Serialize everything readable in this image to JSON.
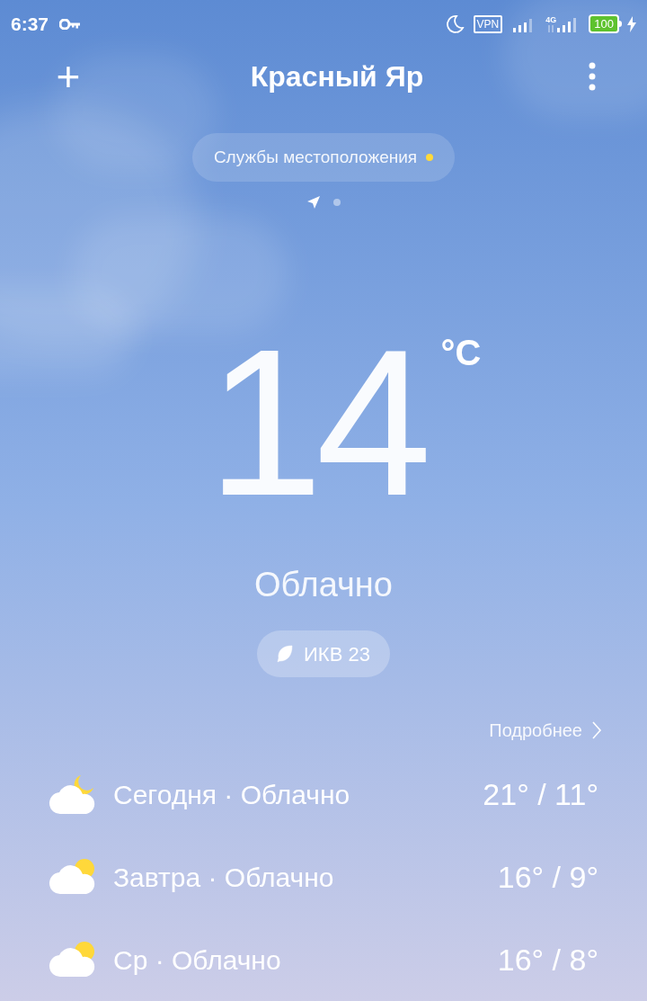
{
  "status_bar": {
    "time": "6:37",
    "vpn": "VPN",
    "network": "4G",
    "battery": "100"
  },
  "header": {
    "add": "+",
    "city": "Красный Яр"
  },
  "location_pill": {
    "label": "Службы местоположения",
    "alert": true
  },
  "pages": [
    {
      "kind": "location",
      "selected": true
    },
    {
      "kind": "dot",
      "selected": false
    }
  ],
  "current": {
    "temperature": "14",
    "unit": "°C",
    "condition": "Облачно"
  },
  "aqi": {
    "label": "ИКВ 23"
  },
  "details_link": "Подробнее",
  "forecast": [
    {
      "kind": "cloud-moon",
      "label": "Сегодня · Облачно",
      "temps": "21° / 11°"
    },
    {
      "kind": "cloud-sun",
      "label": "Завтра · Облачно",
      "temps": "16° / 9°"
    },
    {
      "kind": "cloud-sun",
      "label": "Ср · Облачно",
      "temps": "16° / 8°"
    }
  ]
}
